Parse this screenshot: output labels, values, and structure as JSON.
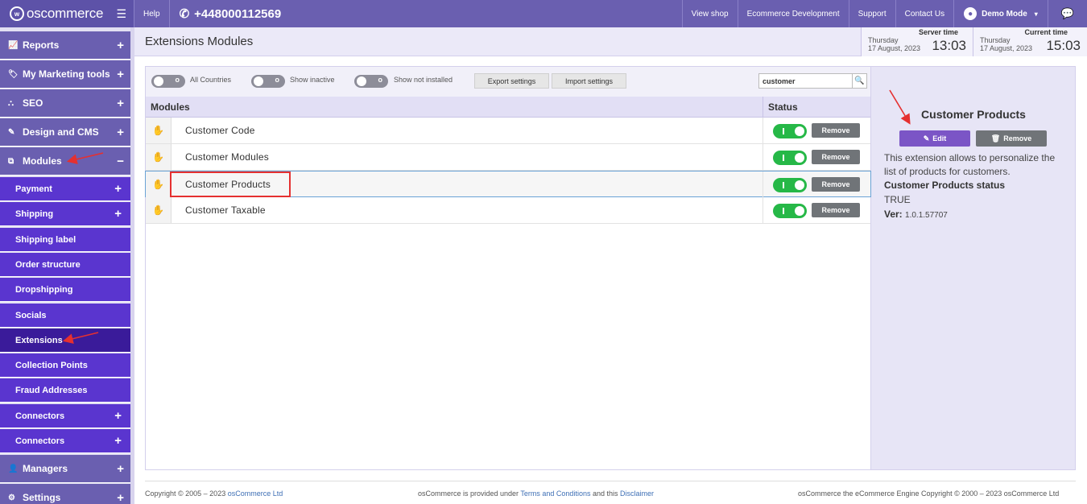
{
  "topbar": {
    "brand": "oscommerce",
    "help": "Help",
    "phone": "+448000112569",
    "links": [
      "View shop",
      "Ecommerce Development",
      "Support",
      "Contact Us"
    ],
    "user": "Demo Mode"
  },
  "sidebar": {
    "top_items": [
      "Reports",
      "My Marketing tools",
      "SEO",
      "Design and CMS",
      "Modules"
    ],
    "sub_items": [
      "Payment",
      "Shipping",
      "Shipping label",
      "Order structure",
      "Dropshipping",
      "Socials",
      "Extensions",
      "Collection Points",
      "Fraud Addresses",
      "Connectors",
      "Connectors"
    ],
    "bottom_items": [
      "Managers",
      "Settings"
    ]
  },
  "header": {
    "title": "Extensions Modules",
    "server": {
      "label": "Server time",
      "day": "Thursday",
      "date": "17 August, 2023",
      "time": "13:03"
    },
    "current": {
      "label": "Current time",
      "day": "Thursday",
      "date": "17 August, 2023",
      "time": "15:03"
    }
  },
  "toolbar": {
    "all_countries": "All Countries",
    "show_inactive": "Show inactive",
    "show_not_installed": "Show not installed",
    "export": "Export settings",
    "import": "Import settings",
    "search_value": "customer"
  },
  "table": {
    "col_modules": "Modules",
    "col_status": "Status",
    "remove_label": "Remove",
    "rows": [
      "Customer Code",
      "Customer Modules",
      "Customer Products",
      "Customer Taxable"
    ]
  },
  "details": {
    "title": "Customer Products",
    "edit": "Edit",
    "remove": "Remove",
    "desc": "This extension allows to personalize the list of products for customers.",
    "status_label": "Customer Products status",
    "status_value": "TRUE",
    "ver_label": "Ver:",
    "ver_value": "1.0.1.57707"
  },
  "footer": {
    "copyright": "Copyright © 2005 – 2023",
    "company": "osCommerce Ltd",
    "provided_a": "osCommerce is provided under",
    "terms": "Terms and Conditions",
    "provided_b": "and this",
    "disclaimer": "Disclaimer",
    "engine": "osCommerce the eCommerce Engine Copyright © 2000 – 2023 osCommerce Ltd"
  },
  "colors": {
    "brand": "#6a5fb0",
    "submenu": "#5a35cf",
    "active": "#3a1b9a",
    "toggle_on": "#26b847",
    "edit": "#7b55c6",
    "annotation": "#e53030"
  }
}
